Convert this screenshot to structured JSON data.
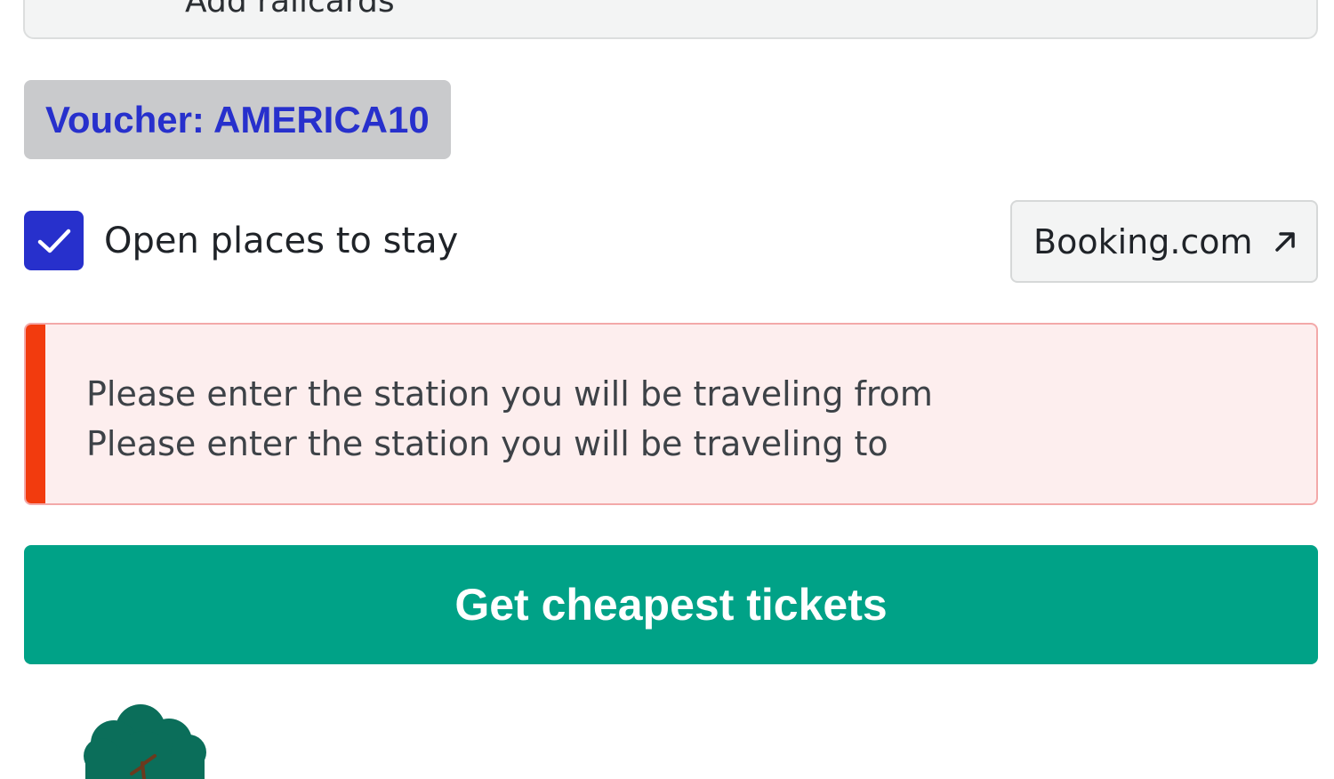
{
  "railcards": {
    "label": "Add railcards"
  },
  "voucher": {
    "label": "Voucher: AMERICA10"
  },
  "stay": {
    "checkbox_checked": true,
    "label": "Open places to stay"
  },
  "booking": {
    "label": "Booking.com",
    "icon": "external-link-arrow-icon"
  },
  "alert": {
    "messages": [
      "Please enter the station you will be traveling from",
      "Please enter the station you will be traveling to"
    ]
  },
  "cta": {
    "label": "Get cheapest tickets"
  },
  "illustration": {
    "icon": "tree-icon"
  },
  "colors": {
    "accent_blue": "#2730cc",
    "cta_green": "#00a287",
    "alert_red": "#f23b0e",
    "alert_bg": "#fdeeee",
    "tree_green": "#0b6e5a"
  }
}
